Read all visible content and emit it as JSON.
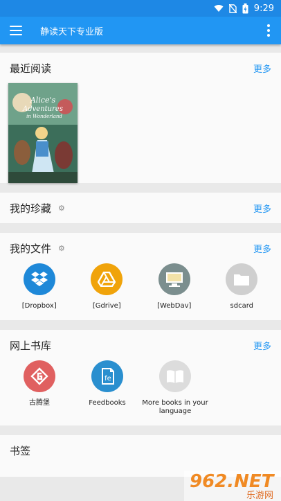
{
  "status_bar": {
    "time": "9:29"
  },
  "app_bar": {
    "title": "静读天下专业版"
  },
  "sections": {
    "recent": {
      "title": "最近阅读",
      "more": "更多",
      "book": {
        "cover_title_line1": "Alice's",
        "cover_title_line2": "Adventures",
        "cover_title_line3": "in Wonderland"
      }
    },
    "favorites": {
      "title": "我的珍藏",
      "more": "更多"
    },
    "files": {
      "title": "我的文件",
      "more": "更多",
      "items": [
        {
          "label": "[Dropbox]",
          "color": "#1e88d8",
          "icon": "dropbox-icon"
        },
        {
          "label": "[Gdrive]",
          "color": "#f0a30a",
          "icon": "gdrive-icon"
        },
        {
          "label": "[WebDav]",
          "color": "#7b8e8e",
          "icon": "computer-icon"
        },
        {
          "label": "sdcard",
          "color": "#cfcfcf",
          "icon": "folder-icon"
        }
      ]
    },
    "online": {
      "title": "网上书库",
      "more": "更多",
      "items": [
        {
          "label": "古腾堡",
          "color": "#e06060",
          "icon": "gutenberg-icon"
        },
        {
          "label": "Feedbooks",
          "color": "#2a8fcf",
          "icon": "feedbooks-icon"
        },
        {
          "label": "More books in your language",
          "color": "#dcdcdc",
          "icon": "book-icon"
        }
      ]
    },
    "bookmarks": {
      "title": "书签"
    }
  },
  "watermark": {
    "text": "962.NET",
    "sub": "乐游网"
  }
}
